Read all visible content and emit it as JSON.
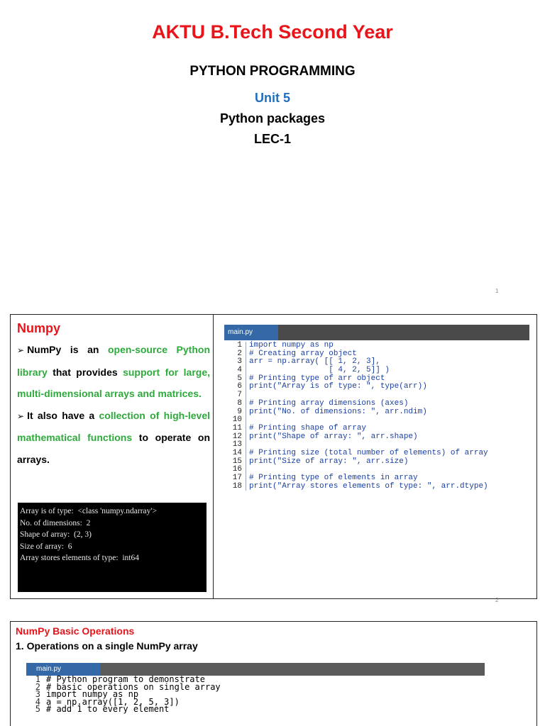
{
  "title_slide": {
    "main_title": "AKTU B.Tech Second Year",
    "subject": "PYTHON PROGRAMMING",
    "unit": "Unit 5",
    "topic": "Python  packages",
    "lecture": "LEC-1",
    "page_number": "1"
  },
  "numpy_slide": {
    "heading": "Numpy",
    "bullets": [
      {
        "marker": "➢",
        "parts": [
          {
            "text": "NumPy is an ",
            "green": false
          },
          {
            "text": "open-source Python library",
            "green": true
          },
          {
            "text": " that provides ",
            "green": false
          },
          {
            "text": "support for large, multi-dimensional arrays and matrices.",
            "green": true
          }
        ]
      },
      {
        "marker": "➢",
        "parts": [
          {
            "text": "It also have a ",
            "green": false
          },
          {
            "text": "collection of high-level mathematical functions",
            "green": true
          },
          {
            "text": " to operate on arrays.",
            "green": false
          }
        ]
      }
    ],
    "terminal_lines": [
      "Array is of type:  <class 'numpy.ndarray'>",
      "No. of dimensions:  2",
      "Shape of array:  (2, 3)",
      "Size of array:  6",
      "Array stores elements of type:  int64"
    ],
    "editor_tab": "main.py",
    "code_lines": [
      {
        "n": "1",
        "code": "import numpy as np"
      },
      {
        "n": "2",
        "code": "# Creating array object"
      },
      {
        "n": "3",
        "code": "arr = np.array( [[ 1, 2, 3],"
      },
      {
        "n": "4",
        "code": "                 [ 4, 2, 5]] )"
      },
      {
        "n": "5",
        "code": "# Printing type of arr object"
      },
      {
        "n": "6",
        "code": "print(\"Array is of type: \", type(arr))"
      },
      {
        "n": "7",
        "code": ""
      },
      {
        "n": "8",
        "code": "# Printing array dimensions (axes)"
      },
      {
        "n": "9",
        "code": "print(\"No. of dimensions: \", arr.ndim)"
      },
      {
        "n": "10",
        "code": ""
      },
      {
        "n": "11",
        "code": "# Printing shape of array"
      },
      {
        "n": "12",
        "code": "print(\"Shape of array: \", arr.shape)"
      },
      {
        "n": "13",
        "code": ""
      },
      {
        "n": "14",
        "code": "# Printing size (total number of elements) of array"
      },
      {
        "n": "15",
        "code": "print(\"Size of array: \", arr.size)"
      },
      {
        "n": "16",
        "code": ""
      },
      {
        "n": "17",
        "code": "# Printing type of elements in array"
      },
      {
        "n": "18",
        "code": "print(\"Array stores elements of type: \", arr.dtype)"
      }
    ],
    "page_number": "2"
  },
  "operations_slide": {
    "heading": "NumPy Basic Operations",
    "subheading": "1. Operations on a single NumPy array",
    "editor_tab": "main.py",
    "code_lines": [
      {
        "n": "1",
        "code": "# Python program to demonstrate"
      },
      {
        "n": "2",
        "code": "# basic operations on single array"
      },
      {
        "n": "3",
        "code": "import numpy as np"
      },
      {
        "n": "4",
        "code": "a = np.array([1, 2, 5, 3])"
      },
      {
        "n": "5",
        "code": "# add 1 to every element"
      }
    ]
  },
  "colors": {
    "title_red": "#e8141a",
    "unit_blue": "#1f6fbf",
    "highlight_green": "#2eaa3c",
    "editor_tab_blue": "#3468a6",
    "code_blue": "#1b3fa0"
  }
}
